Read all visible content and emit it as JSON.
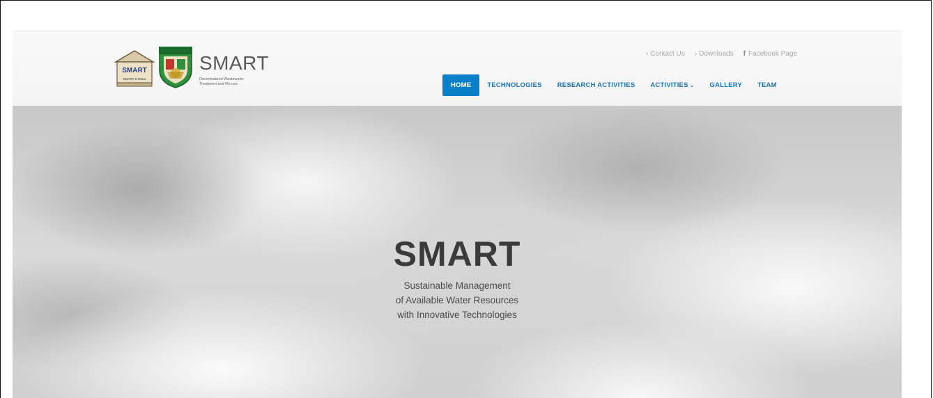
{
  "logo": {
    "house_text": "SMART",
    "house_caption": "SMART & R3Uo",
    "title": "SMART",
    "subtitle": "Decentralized Wastewater Treatment and Re-use"
  },
  "toplinks": {
    "contact": "Contact Us",
    "downloads": "Downloads",
    "facebook": "Facebook Page"
  },
  "nav": {
    "items": [
      {
        "label": "HOME",
        "active": true
      },
      {
        "label": "TECHNOLOGIES"
      },
      {
        "label": "RESEARCH ACTIVITIES"
      },
      {
        "label": "ACTIVITIES"
      },
      {
        "label": "GALLERY"
      },
      {
        "label": "TEAM"
      }
    ]
  },
  "hero": {
    "title": "SMART",
    "lines": [
      "Sustainable Management",
      "of Available Water Resources",
      "with Innovative Technologies"
    ]
  },
  "icons": {
    "chevron": "chevron-right-icon",
    "facebook": "facebook-icon",
    "caret": "chevron-down-icon"
  },
  "colors": {
    "nav_text": "#1a75b5",
    "nav_active_bg": "#0a80c9"
  }
}
